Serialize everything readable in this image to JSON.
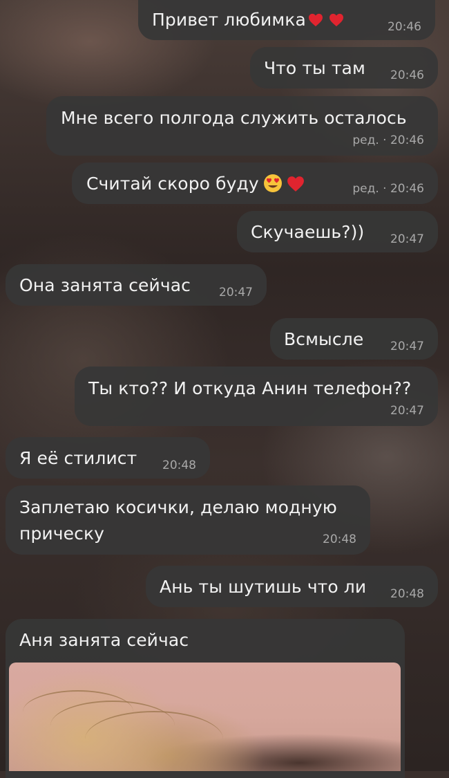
{
  "chat": {
    "messages": [
      {
        "id": "m1",
        "side": "out",
        "text": "Привет любимка",
        "emoji": [
          "heart",
          "heart"
        ],
        "time": "20:46",
        "edited": false
      },
      {
        "id": "m2",
        "side": "out",
        "text": "Что ты там",
        "time": "20:46",
        "edited": false
      },
      {
        "id": "m3",
        "side": "out",
        "text": "Мне всего полгода служить осталось",
        "time": "20:46",
        "edited": true,
        "edited_label": "ред. · 20:46"
      },
      {
        "id": "m4",
        "side": "out",
        "text": "Считай скоро буду",
        "emoji": [
          "heart-eyes",
          "heart"
        ],
        "time": "20:46",
        "edited": true,
        "edited_label": "ред. · 20:46"
      },
      {
        "id": "m5",
        "side": "out",
        "text": "Скучаешь?))",
        "time": "20:47",
        "edited": false
      },
      {
        "id": "m6",
        "side": "in",
        "text": "Она занята сейчас",
        "time": "20:47",
        "edited": false
      },
      {
        "id": "m7",
        "side": "out",
        "text": "Всмысле",
        "time": "20:47",
        "edited": false
      },
      {
        "id": "m8",
        "side": "out",
        "text": "Ты кто?? И откуда Анин телефон??",
        "time": "20:47",
        "edited": false
      },
      {
        "id": "m9",
        "side": "in",
        "text": "Я её стилист",
        "time": "20:48",
        "edited": false
      },
      {
        "id": "m10",
        "side": "in",
        "text_line1": "Заплетаю косички, делаю модную",
        "text_line2": "прическу",
        "time": "20:48",
        "edited": false
      },
      {
        "id": "m11",
        "side": "out",
        "text": "Ань ты шутишь что ли",
        "time": "20:48",
        "edited": false
      },
      {
        "id": "m12",
        "side": "in",
        "text": "Аня занята сейчас",
        "attachment": "photo",
        "edited": false
      }
    ]
  },
  "colors": {
    "bubble": "#373737",
    "text": "#f2f2f2",
    "meta": "#a9a9a9",
    "heart": "#e0242f",
    "emoji_face": "#f7c33b"
  }
}
